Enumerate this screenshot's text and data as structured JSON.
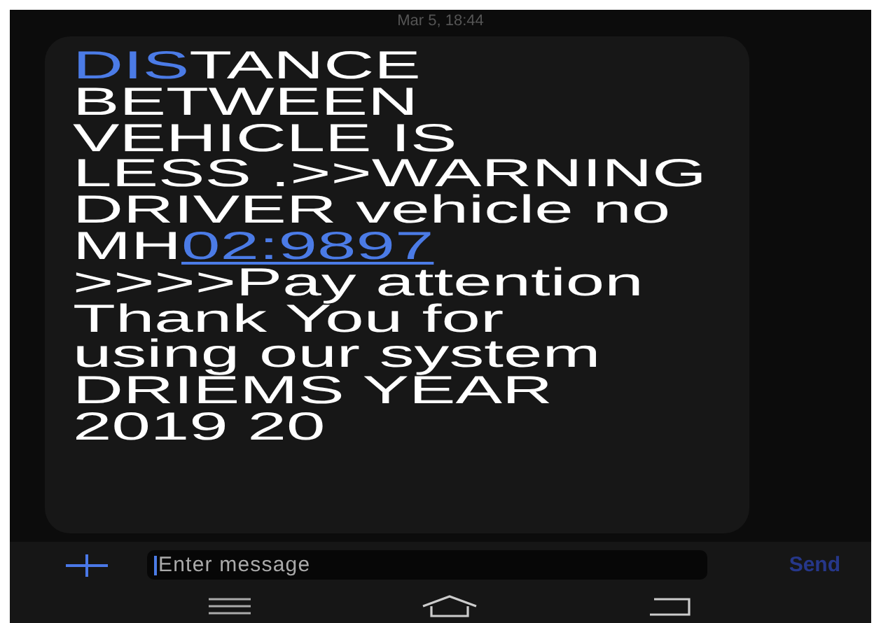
{
  "timestamp": "Mar 5, 18:44",
  "message": [
    {
      "kind": "highlight",
      "text": "DIS"
    },
    {
      "kind": "text",
      "text": "TANCE\nBETWEEN\nVEHICLE IS\nLESS .>>WARNING\nDRIVER vehicle no\nMH"
    },
    {
      "kind": "link",
      "text": "02:9897"
    },
    {
      "kind": "text",
      "text": "\n>>>>Pay attention\nThank You for\nusing our system\nDRIEMS YEAR\n2019 20"
    }
  ],
  "composer": {
    "placeholder": "Enter message",
    "send": "Send"
  }
}
